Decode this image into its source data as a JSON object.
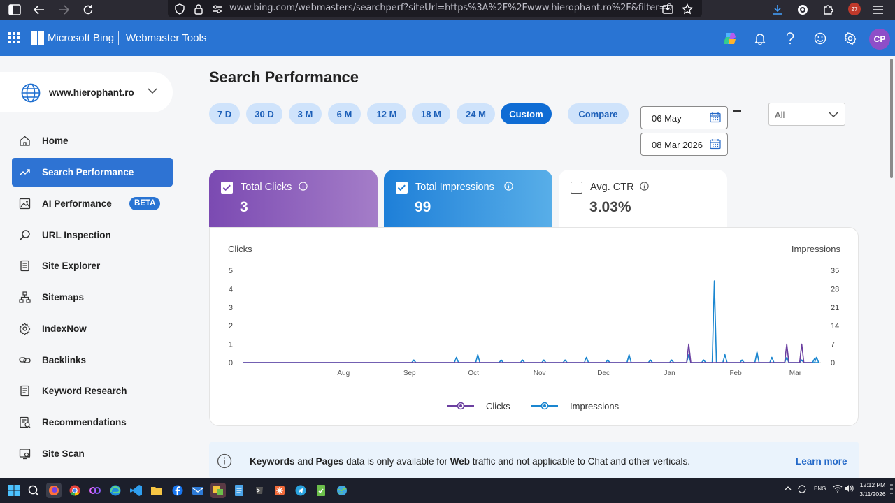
{
  "browser": {
    "url": "www.bing.com/webmasters/searchperf?siteUrl=https%3A%2F%2Fwww.hierophant.ro%2F&filter=0",
    "notification_count": "27"
  },
  "header": {
    "brand": "Microsoft Bing",
    "product": "Webmaster Tools",
    "avatar_initials": "CP"
  },
  "sidebar": {
    "site": "www.hierophant.ro",
    "items": [
      {
        "label": "Home",
        "icon": "home-icon"
      },
      {
        "label": "Search Performance",
        "icon": "trend-icon"
      },
      {
        "label": "AI Performance",
        "icon": "ai-image-icon",
        "badge": "BETA"
      },
      {
        "label": "URL Inspection",
        "icon": "search-icon"
      },
      {
        "label": "Site Explorer",
        "icon": "document-icon"
      },
      {
        "label": "Sitemaps",
        "icon": "sitemap-icon"
      },
      {
        "label": "IndexNow",
        "icon": "gear-icon"
      },
      {
        "label": "Backlinks",
        "icon": "link-icon"
      },
      {
        "label": "Keyword Research",
        "icon": "keyword-icon"
      },
      {
        "label": "Recommendations",
        "icon": "recommendations-icon"
      },
      {
        "label": "Site Scan",
        "icon": "site-scan-icon"
      }
    ],
    "active_index": 1
  },
  "main": {
    "title": "Search Performance",
    "ranges": [
      "7 D",
      "30 D",
      "3 M",
      "6 M",
      "12 M",
      "18 M",
      "24 M",
      "Custom"
    ],
    "active_range": "Custom",
    "compare_label": "Compare",
    "date_from": "06 May",
    "date_to": "08 Mar 2026",
    "filter_value": "All",
    "metrics": {
      "clicks": {
        "label": "Total Clicks",
        "value": "3",
        "checked": true
      },
      "impressions": {
        "label": "Total Impressions",
        "value": "99",
        "checked": true
      },
      "ctr": {
        "label": "Avg. CTR",
        "value": "3.03%",
        "checked": false
      }
    },
    "banner": {
      "kw": "Keywords",
      "and": "and",
      "pages": "Pages",
      "middle": "data is only available for",
      "web": "Web",
      "rest": "traffic and not applicable to Chat and other verticals.",
      "link": "Learn more"
    }
  },
  "colors": {
    "accent": "#2974d3",
    "clicks": "#6b3fa0",
    "impressions": "#1a86d0"
  },
  "chart_data": {
    "type": "line",
    "ylabel": "Clicks",
    "y2label": "Impressions",
    "ylim": [
      0,
      5
    ],
    "y2lim": [
      0,
      35
    ],
    "yticks": [
      0,
      1,
      2,
      3,
      4,
      5
    ],
    "y2ticks": [
      0,
      7,
      14,
      21,
      28,
      35
    ],
    "x_ticks": [
      "Aug",
      "Sep",
      "Oct",
      "Nov",
      "Dec",
      "Jan",
      "Feb",
      "Mar"
    ],
    "x": [
      "2025-06-14",
      "2025-08-03",
      "2025-09-02",
      "2025-09-12",
      "2025-09-22",
      "2025-10-02",
      "2025-10-13",
      "2025-10-23",
      "2025-11-02",
      "2025-11-12",
      "2025-11-22",
      "2025-12-02",
      "2025-12-12",
      "2025-12-22",
      "2026-01-01",
      "2026-01-09",
      "2026-01-16",
      "2026-01-21",
      "2026-01-26",
      "2026-02-03",
      "2026-02-10",
      "2026-02-17",
      "2026-02-24",
      "2026-03-03",
      "2026-03-10"
    ],
    "series": [
      {
        "name": "Clicks",
        "values": [
          0,
          0,
          0,
          0,
          0,
          0,
          0,
          0,
          0,
          0,
          0,
          0,
          0,
          0,
          0,
          1,
          0,
          0,
          0,
          0,
          0,
          0,
          1,
          1,
          0
        ]
      },
      {
        "name": "Impressions",
        "values": [
          0,
          0,
          1,
          0,
          2,
          3,
          1,
          1,
          1,
          1,
          2,
          1,
          3,
          1,
          1,
          3,
          1,
          31,
          3,
          1,
          4,
          2,
          2,
          1,
          2
        ]
      }
    ],
    "legend": "bottom-center"
  }
}
